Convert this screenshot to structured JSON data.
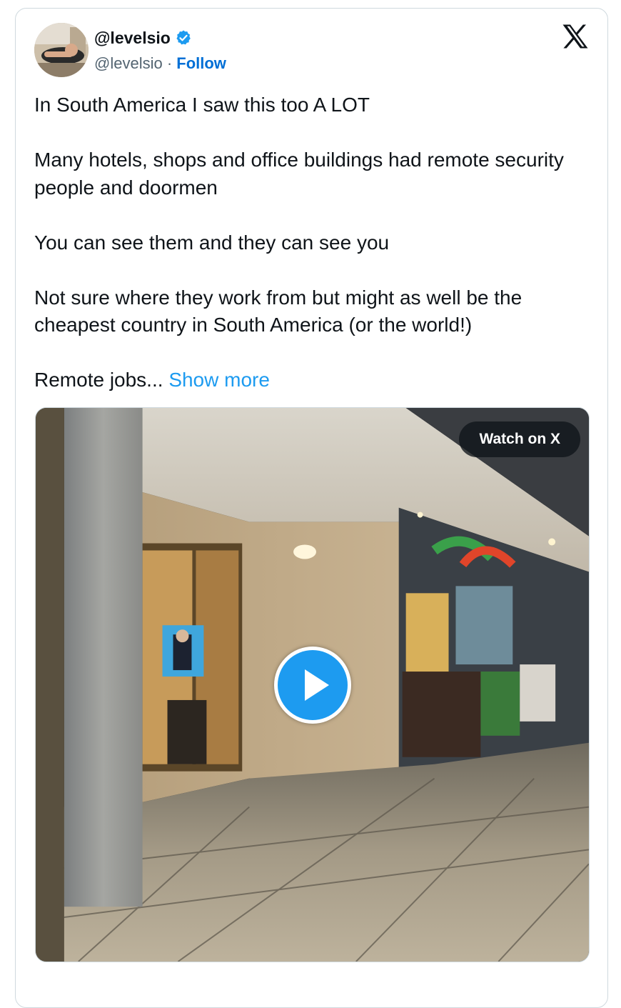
{
  "author": {
    "display_name": "@levelsio",
    "handle": "@levelsio",
    "separator": " · ",
    "follow_label": "Follow",
    "verified_icon": "verified-badge-icon"
  },
  "brand": {
    "logo_icon": "x-logo-icon"
  },
  "tweet": {
    "paragraphs": [
      "In South America I saw this too A LOT",
      "Many hotels, shops and office buildings had remote security people and doormen",
      "You can see them and they can see you",
      "Not sure where they work from but might as well be the cheapest country in South America (or the world!)"
    ],
    "truncated_text": "Remote jobs...",
    "show_more_label": "Show more"
  },
  "media": {
    "type": "video",
    "watch_label": "Watch on X",
    "play_icon": "play-icon"
  },
  "colors": {
    "link": "#1d9bf0",
    "follow": "#006fd6",
    "text": "#0f1419",
    "secondary_text": "#536471",
    "border": "#cfd9de"
  }
}
